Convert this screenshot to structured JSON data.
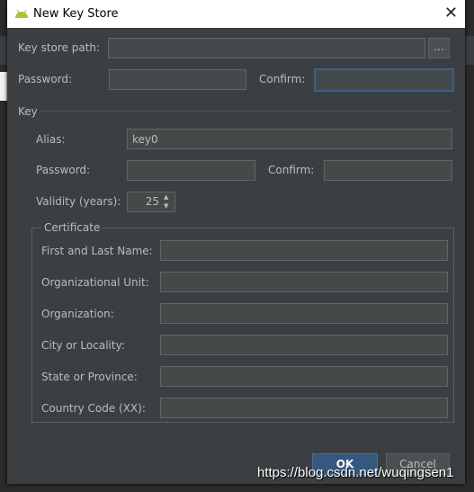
{
  "window": {
    "title": "New Key Store",
    "icon": "android-icon"
  },
  "keystore": {
    "path_label": "Key store path:",
    "path_value": "",
    "browse_label": "...",
    "password_label": "Password:",
    "confirm_label": "Confirm:"
  },
  "key": {
    "section_label": "Key",
    "alias_label": "Alias:",
    "alias_value": "key0",
    "password_label": "Password:",
    "confirm_label": "Confirm:",
    "validity_label": "Validity (years):",
    "validity_value": "25"
  },
  "certificate": {
    "title": "Certificate",
    "fields": [
      {
        "label": "First and Last Name:",
        "value": ""
      },
      {
        "label": "Organizational Unit:",
        "value": ""
      },
      {
        "label": "Organization:",
        "value": ""
      },
      {
        "label": "City or Locality:",
        "value": ""
      },
      {
        "label": "State or Province:",
        "value": ""
      },
      {
        "label": "Country Code (XX):",
        "value": ""
      }
    ]
  },
  "buttons": {
    "ok": "OK",
    "cancel": "Cancel"
  },
  "watermark": "https://blog.csdn.net/wuqingsen1",
  "colors": {
    "dialog_bg": "#3c3f41",
    "field_bg": "#45494a",
    "ok_button": "#365880",
    "focus_border": "#3d5f87"
  }
}
